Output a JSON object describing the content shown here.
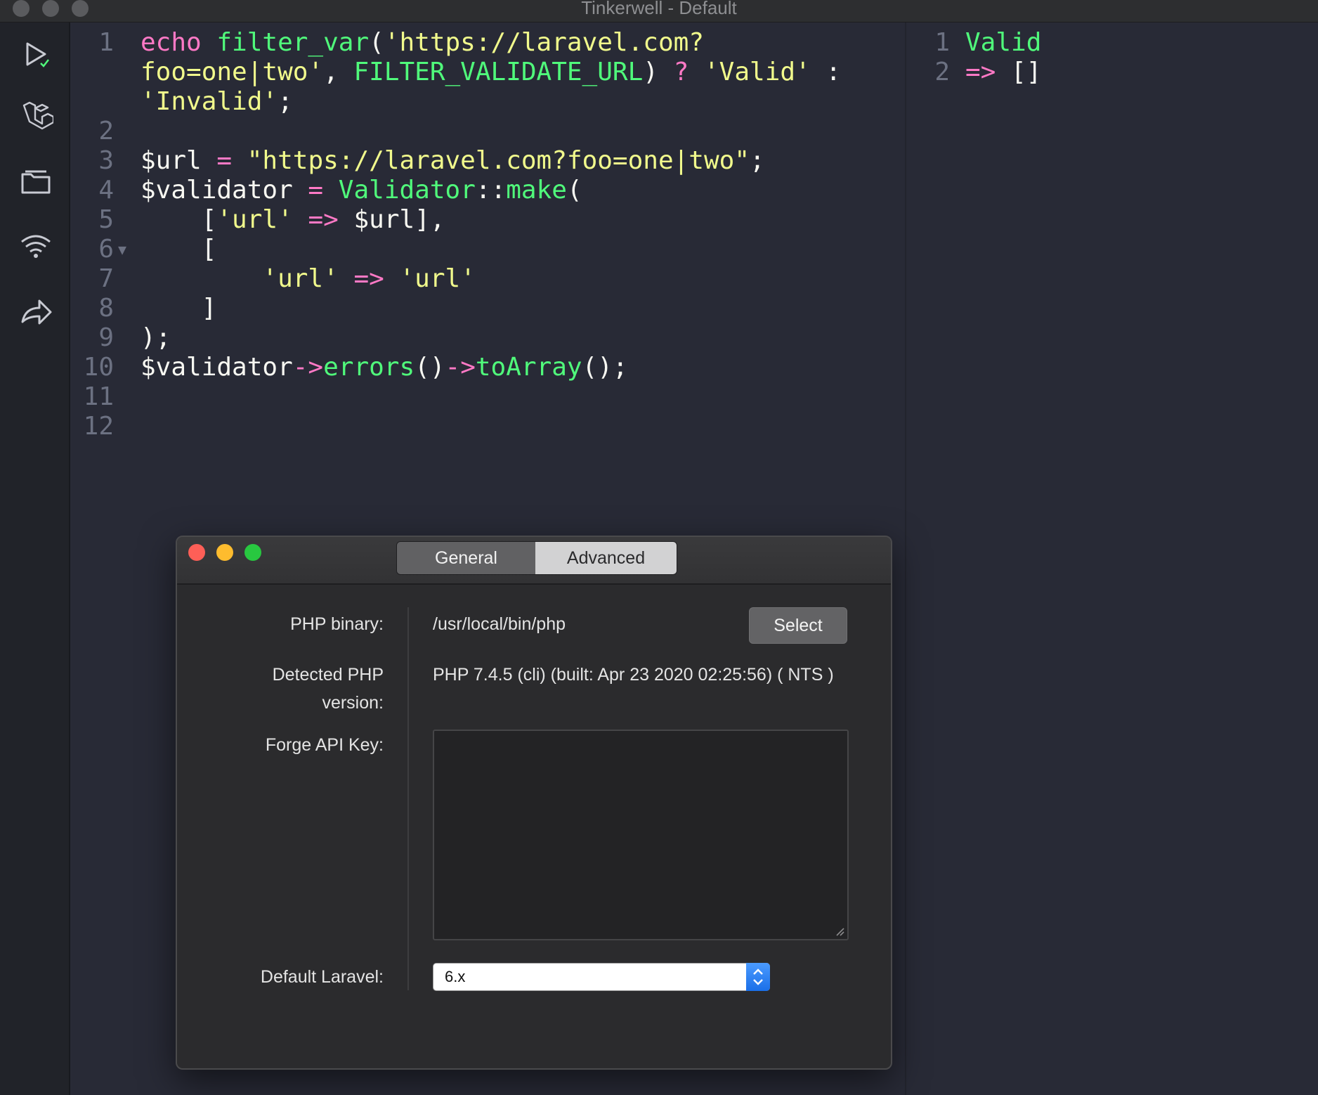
{
  "window": {
    "title": "Tinkerwell - Default"
  },
  "sidebar": {
    "icons": [
      "run-icon",
      "laravel-icon",
      "folder-icon",
      "wifi-icon",
      "share-icon"
    ]
  },
  "editor": {
    "line_numbers": [
      "1",
      "2",
      "3",
      "4",
      "5",
      "6",
      "7",
      "8",
      "9",
      "10",
      "11",
      "12"
    ],
    "lines": [
      [
        {
          "t": "echo ",
          "c": "k"
        },
        {
          "t": "filter_var",
          "c": "f"
        },
        {
          "t": "(",
          "c": "p"
        },
        {
          "t": "'https://laravel.com?",
          "c": "s"
        }
      ],
      [
        {
          "t": "foo=one|two'",
          "c": "s"
        },
        {
          "t": ", ",
          "c": "p"
        },
        {
          "t": "FILTER_VALIDATE_URL",
          "c": "f"
        },
        {
          "t": ") ",
          "c": "p"
        },
        {
          "t": "?",
          "c": "k"
        },
        {
          "t": " ",
          "c": "p"
        },
        {
          "t": "'Valid'",
          "c": "s"
        },
        {
          "t": " :",
          "c": "p"
        }
      ],
      [
        {
          "t": "'Invalid'",
          "c": "s"
        },
        {
          "t": ";",
          "c": "p"
        }
      ],
      [],
      [
        {
          "t": "$url ",
          "c": "p"
        },
        {
          "t": "=",
          "c": "k"
        },
        {
          "t": " ",
          "c": "p"
        },
        {
          "t": "\"https://laravel.com?foo=one|two\"",
          "c": "s"
        },
        {
          "t": ";",
          "c": "p"
        }
      ],
      [
        {
          "t": "$validator ",
          "c": "p"
        },
        {
          "t": "=",
          "c": "k"
        },
        {
          "t": " ",
          "c": "p"
        },
        {
          "t": "Validator",
          "c": "f"
        },
        {
          "t": "::",
          "c": "p"
        },
        {
          "t": "make",
          "c": "f"
        },
        {
          "t": "(",
          "c": "p"
        }
      ],
      [
        {
          "t": "    [",
          "c": "p"
        },
        {
          "t": "'url'",
          "c": "s"
        },
        {
          "t": " ",
          "c": "p"
        },
        {
          "t": "=>",
          "c": "k"
        },
        {
          "t": " $url],",
          "c": "p"
        }
      ],
      [
        {
          "t": "    [",
          "c": "p"
        }
      ],
      [
        {
          "t": "        ",
          "c": "p"
        },
        {
          "t": "'url'",
          "c": "s"
        },
        {
          "t": " ",
          "c": "p"
        },
        {
          "t": "=>",
          "c": "k"
        },
        {
          "t": " ",
          "c": "p"
        },
        {
          "t": "'url'",
          "c": "s"
        }
      ],
      [
        {
          "t": "    ]",
          "c": "p"
        }
      ],
      [
        {
          "t": ");",
          "c": "p"
        }
      ],
      [
        {
          "t": "$validator",
          "c": "p"
        },
        {
          "t": "->",
          "c": "k"
        },
        {
          "t": "errors",
          "c": "f"
        },
        {
          "t": "()",
          "c": "p"
        },
        {
          "t": "->",
          "c": "k"
        },
        {
          "t": "toArray",
          "c": "f"
        },
        {
          "t": "();",
          "c": "p"
        }
      ],
      [],
      []
    ]
  },
  "output": {
    "line_numbers": [
      "1",
      "2"
    ],
    "line1": "Valid",
    "line2_arrow": "=>",
    "line2_value": " []"
  },
  "dialog": {
    "tabs": {
      "general": "General",
      "advanced": "Advanced"
    },
    "php_binary": {
      "label": "PHP binary:",
      "value": "/usr/local/bin/php",
      "button": "Select"
    },
    "php_version": {
      "label_line1": "Detected PHP",
      "label_line2": "version:",
      "value": "PHP 7.4.5 (cli) (built: Apr 23 2020 02:25:56) ( NTS )"
    },
    "forge_key": {
      "label": "Forge API Key:",
      "value": ""
    },
    "default_laravel": {
      "label": "Default Laravel:",
      "value": "6.x"
    }
  },
  "colors": {
    "keyword": "#ff79c6",
    "function": "#50fa7b",
    "string": "#f1fa8c",
    "plain": "#f8f8f2",
    "close": "#fe5f57",
    "minimize": "#febc2e",
    "zoom": "#28c840"
  }
}
